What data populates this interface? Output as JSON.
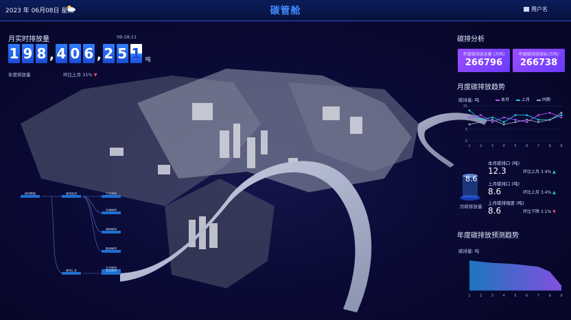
{
  "header": {
    "date": "2023 年 06月08日",
    "weekday": "星期",
    "title": "碳管舱",
    "user": "用户名"
  },
  "left": {
    "title": "月实时排放量",
    "clock": "09:28:11",
    "digits": [
      "1",
      "9",
      "8",
      ",",
      "4",
      "0",
      "6",
      ",",
      "2",
      "5",
      "1"
    ],
    "unit": "吨",
    "compare_label": "环比上月",
    "compare_value": "31%",
    "year_label": "年度排放量"
  },
  "right": {
    "analysis_title": "碳排分析",
    "kpi": [
      {
        "label": "年度碳排放总量 (万吨)",
        "value": "266796"
      },
      {
        "label": "年度碳排放指标(万吨)",
        "value": "266738"
      }
    ],
    "trend_title": "月度碳排放趋势",
    "trend_unit": "碳排量: 吨",
    "legend": [
      "本月",
      "上月",
      "同期"
    ],
    "indicators": [
      {
        "label": "本月碳排口 (吨)",
        "value": "12.3",
        "chg_label": "环比上月",
        "chg": "3.4%",
        "dir": "up"
      },
      {
        "label": "上月碳排口 (吨)",
        "value": "8.6",
        "chg_label": "环比上月",
        "chg": "3.4%",
        "dir": "up"
      },
      {
        "label": "上月碳排强度 (吨)",
        "value": "8.6",
        "chg_label": "环比下降",
        "chg": "3.1%",
        "dir": "down"
      }
    ],
    "gauge_value": "8.6",
    "gauge_label": "月碳排放量",
    "forecast_title": "年度碳排放预测趋势",
    "forecast_unit": "碳排量: 吨"
  },
  "flow": {
    "nodes": [
      "碳排数据",
      "碳排监测",
      "工业碳排",
      "交通碳排",
      "建筑碳排",
      "能源碳排",
      "生活碳排",
      "碳排汇总",
      "农业碳排"
    ]
  },
  "chart_data": [
    {
      "type": "line",
      "title": "月度碳排放趋势",
      "ylabel": "碳排量: 吨",
      "x": [
        "1",
        "2",
        "3",
        "4",
        "5",
        "6",
        "7",
        "8",
        "9"
      ],
      "ylim": [
        0,
        15
      ],
      "series": [
        {
          "name": "本月",
          "values": [
            10,
            11,
            8,
            10,
            9,
            8,
            11,
            12,
            10
          ]
        },
        {
          "name": "上月",
          "values": [
            13,
            9,
            10,
            8,
            11,
            11,
            9,
            9,
            11
          ]
        },
        {
          "name": "同期",
          "values": [
            7,
            8,
            9,
            7,
            8,
            9,
            8,
            9,
            12
          ]
        }
      ]
    },
    {
      "type": "area",
      "title": "年度碳排放预测趋势",
      "ylabel": "碳排量: 吨",
      "x": [
        "1",
        "2",
        "3",
        "4",
        "5",
        "6",
        "7",
        "8",
        "9"
      ],
      "series": [
        {
          "name": "",
          "values": [
            12,
            11.5,
            11,
            10.8,
            10.5,
            10,
            9.5,
            7.5,
            2
          ]
        }
      ]
    }
  ],
  "colors": {
    "accent": "#3f8cff",
    "kpi": "#8a46ff",
    "up": "#27d6a0",
    "down": "#ff4a6a"
  }
}
